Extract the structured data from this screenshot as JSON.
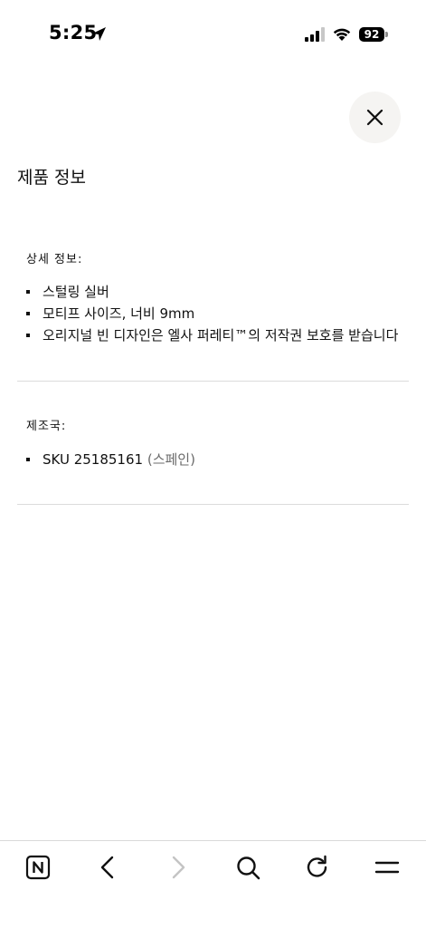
{
  "status_bar": {
    "time": "5:25",
    "battery": "92"
  },
  "icons": {
    "location": "location-arrow-icon",
    "signal": "cellular-signal-icon",
    "wifi": "wifi-icon",
    "close": "close-icon",
    "n_logo": "n-logo-icon",
    "back": "chevron-left-icon",
    "forward": "chevron-right-icon",
    "search": "search-icon",
    "reload": "reload-icon",
    "menu": "menu-icon"
  },
  "page": {
    "title": "제품 정보"
  },
  "details": {
    "label": "상세 정보:",
    "items": [
      "스털링 실버",
      "모티프 사이즈, 너비 9mm",
      "오리지널 빈 디자인은 엘사 퍼레티™의 저작권 보호를 받습니다"
    ]
  },
  "origin": {
    "label": "제조국:",
    "sku": "SKU 25185161",
    "country": "(스페인)"
  },
  "colors": {
    "close_bg": "#f5f4f2",
    "divider": "#dcdcdc",
    "disabled_icon": "#c4c4c4"
  }
}
